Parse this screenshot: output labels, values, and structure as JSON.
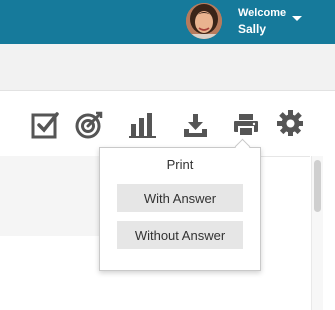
{
  "header": {
    "welcome_label": "Welcome",
    "user_name": "Sally",
    "background_color": "#167a9b"
  },
  "toolbar": {
    "icons": [
      "checkbox-icon",
      "target-icon",
      "bar-chart-icon",
      "download-icon",
      "print-icon",
      "gear-icon"
    ],
    "icon_color": "#555555"
  },
  "print_menu": {
    "title": "Print",
    "options": [
      "With Answer",
      "Without Answer"
    ]
  }
}
